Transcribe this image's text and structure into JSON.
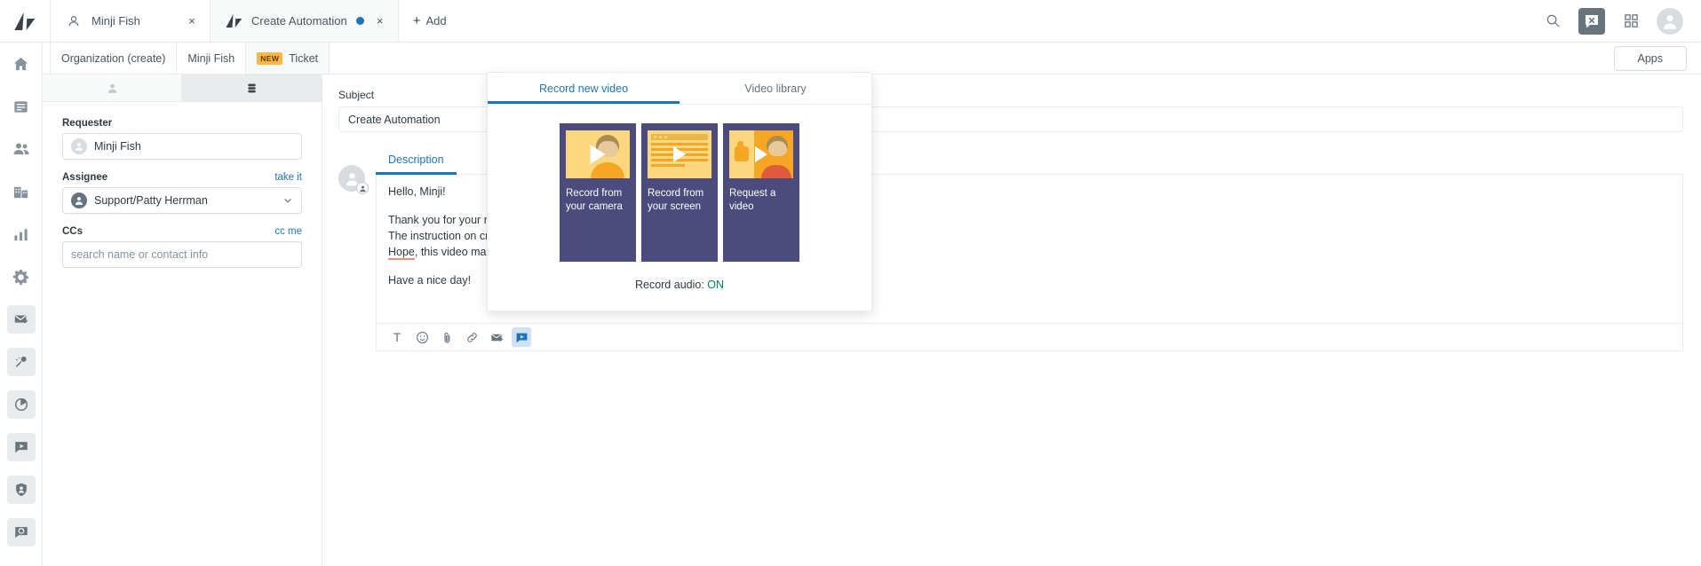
{
  "app": {
    "logo": "zendesk-logo"
  },
  "tabbar": {
    "tabs": [
      {
        "label": "Minji Fish",
        "icon": "user-icon",
        "active": false,
        "has_dot": false,
        "close": "×"
      },
      {
        "label": "Create Automation",
        "icon": "zendesk-logo",
        "active": true,
        "has_dot": true,
        "close": "×"
      }
    ],
    "add_label": "Add",
    "add_plus": "+",
    "actions": [
      {
        "name": "search-icon",
        "selected": false
      },
      {
        "name": "chat-x-icon",
        "selected": true
      },
      {
        "name": "apps-grid-icon",
        "selected": false
      },
      {
        "name": "user-avatar-icon",
        "selected": false
      }
    ]
  },
  "rail": {
    "items": [
      {
        "name": "home-icon",
        "boxed": false
      },
      {
        "name": "views-icon",
        "boxed": false
      },
      {
        "name": "customers-icon",
        "boxed": false
      },
      {
        "name": "organizations-icon",
        "boxed": false
      },
      {
        "name": "reporting-icon",
        "boxed": false
      },
      {
        "name": "admin-gear-icon",
        "boxed": false
      },
      {
        "name": "mail-check-icon",
        "boxed": true
      },
      {
        "name": "magic-wand-icon",
        "boxed": true
      },
      {
        "name": "pie-chart-icon",
        "boxed": true
      },
      {
        "name": "video-play-icon",
        "boxed": true
      },
      {
        "name": "shield-user-icon",
        "boxed": true
      },
      {
        "name": "chat-refresh-icon",
        "boxed": true
      }
    ]
  },
  "breadcrumb": {
    "items": [
      {
        "label": "Organization (create)",
        "badge": "",
        "active": false
      },
      {
        "label": "Minji Fish",
        "badge": "",
        "active": false
      },
      {
        "label": "Ticket",
        "badge": "NEW",
        "active": true
      }
    ],
    "apps_label": "Apps"
  },
  "ticket_pane": {
    "tabs": [
      {
        "name": "user-tab-icon",
        "active": false
      },
      {
        "name": "ticket-tab-icon",
        "active": true
      }
    ],
    "requester": {
      "label": "Requester",
      "value": "Minji Fish"
    },
    "assignee": {
      "label": "Assignee",
      "action": "take it",
      "value": "Support/Patty Herrman"
    },
    "ccs": {
      "label": "CCs",
      "action": "cc me",
      "placeholder": "search name or contact info",
      "value": ""
    }
  },
  "ticket_form": {
    "subject_label": "Subject",
    "subject_value": "Create Automation",
    "editor": {
      "tab_label": "Description",
      "paragraphs": [
        "Hello, Minji!",
        "Thank you for your request.",
        "The instruction on creating",
        "Hope",
        ", this video makes the",
        "Have a nice day!"
      ],
      "greeting": "Hello, Minji!",
      "line1": "Thank you for your request.",
      "line2": "The instruction on creating",
      "spell_word": "Hope",
      "line3": ", this video makes the",
      "closing": "Have a nice day!"
    },
    "toolbar": [
      {
        "name": "text-format-icon",
        "glyph": "T",
        "selected": false
      },
      {
        "name": "emoji-icon",
        "glyph": "",
        "selected": false
      },
      {
        "name": "attachment-icon",
        "glyph": "",
        "selected": false
      },
      {
        "name": "link-icon",
        "glyph": "",
        "selected": false
      },
      {
        "name": "email-icon",
        "glyph": "",
        "selected": false
      },
      {
        "name": "video-icon",
        "glyph": "",
        "selected": true
      }
    ]
  },
  "video_popup": {
    "tabs": [
      {
        "label": "Record new video",
        "active": true
      },
      {
        "label": "Video library",
        "active": false
      }
    ],
    "cards": [
      {
        "title": "Record from your camera",
        "art": "camera-thumb"
      },
      {
        "title": "Record from your screen",
        "art": "screen-thumb"
      },
      {
        "title": "Request a video",
        "art": "request-thumb"
      }
    ],
    "audio_label": "Record audio:",
    "audio_state": "ON",
    "audio_color": "#038153"
  }
}
